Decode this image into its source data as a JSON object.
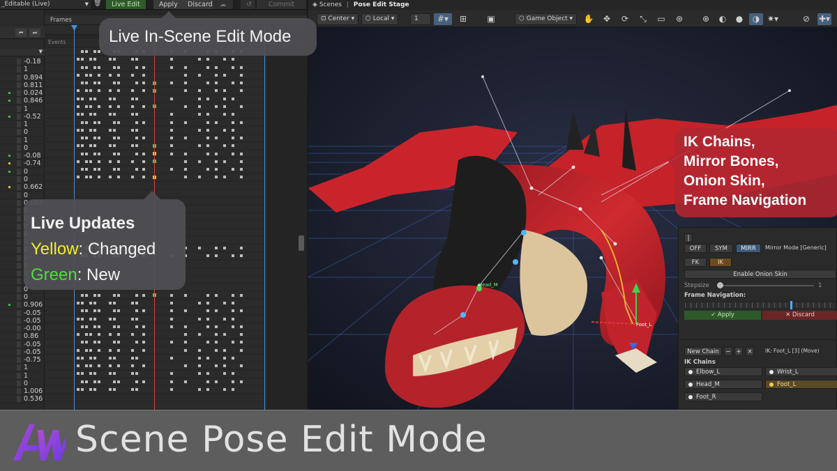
{
  "animation_window": {
    "clip_name": "_Editable (Live)",
    "toolbar": {
      "live_edit_label": "Live Edit",
      "apply_label": "Apply",
      "discard_label": "Discard",
      "commit_label": "Commit"
    },
    "frames_label": "Frames",
    "events_label": "Events",
    "property_values": [
      "-0.18",
      "1",
      "0.894",
      "0.811",
      "0.024",
      "0.846",
      "1",
      "-0.52",
      "1",
      "0",
      "1",
      "0",
      "-0.08",
      "-0.74",
      "0",
      "0",
      "0.662",
      "0",
      "0.682",
      "0",
      "0",
      "0",
      "0",
      "0",
      "0",
      "0",
      "0",
      "0",
      "0",
      "0",
      "0",
      "0.906",
      "-0.05",
      "-0.05",
      "-0.00",
      "0.86",
      "-0.05",
      "-0.05",
      "-0.75",
      "1",
      "1",
      "0",
      "1.006",
      "0.536"
    ],
    "change_indicators": [
      "",
      "",
      "",
      "",
      "new",
      "new",
      "",
      "new",
      "",
      "",
      "",
      "",
      "new",
      "changed",
      "new",
      "",
      "changed",
      "",
      "",
      "",
      "",
      "",
      "",
      "",
      "",
      "",
      "",
      "",
      "",
      "",
      "",
      "new",
      "",
      "",
      "",
      "",
      "",
      "",
      "",
      "",
      "",
      "",
      "",
      ""
    ]
  },
  "callouts": {
    "live_mode": "Live In-Scene Edit Mode",
    "live_updates_title": "Live Updates",
    "yellow_word": "Yellow",
    "changed_word": ": Changed",
    "green_word": "Green",
    "new_word": ": New",
    "ik_lines": [
      "IK Chains,",
      "Mirror Bones,",
      "Onion Skin,",
      "Frame Navigation"
    ]
  },
  "scene_window": {
    "tab_scenes": "Scenes",
    "tab_separator": "|",
    "tab_stage": "Pose Edit Stage",
    "toolbar": {
      "pivot": "Center",
      "space": "Local",
      "snap_value": "1",
      "game_object": "Game Object"
    },
    "bone_labels": [
      "Head_M",
      "Foot_L"
    ]
  },
  "pose_panel": {
    "mirror_off": "OFF",
    "mirror_sym": "SYM",
    "mirror_mirr": "MIRR",
    "mirror_mode_label": "Mirror Mode",
    "mirror_mode_value": "[Generic]",
    "fk_label": "FK",
    "ik_label": "IK",
    "onion_skin_label": "Enable Onion Skin",
    "stepsize_label": "Stepsize",
    "stepsize_value": "1",
    "frame_nav_label": "Frame Navigation:",
    "apply_label": "✓ Apply",
    "discard_label": "✕ Discard",
    "new_chain_label": "New Chain",
    "chain_ops": [
      "−",
      "+",
      "×"
    ],
    "active_chain_info": "IK: Foot_L [3] (Move)",
    "ik_chains_title": "IK Chains",
    "chains": [
      {
        "name": "Elbow_L",
        "active": false
      },
      {
        "name": "Wrist_L",
        "active": false
      },
      {
        "name": "Head_M",
        "active": false
      },
      {
        "name": "Foot_L",
        "active": true
      },
      {
        "name": "Foot_R",
        "active": false
      }
    ]
  },
  "banner": {
    "title": "Scene Pose Edit Mode"
  },
  "colors": {
    "changed": "#e6c531",
    "new": "#44d04f",
    "ik_callout": "#b02630",
    "dragon_red": "#c8202a"
  }
}
